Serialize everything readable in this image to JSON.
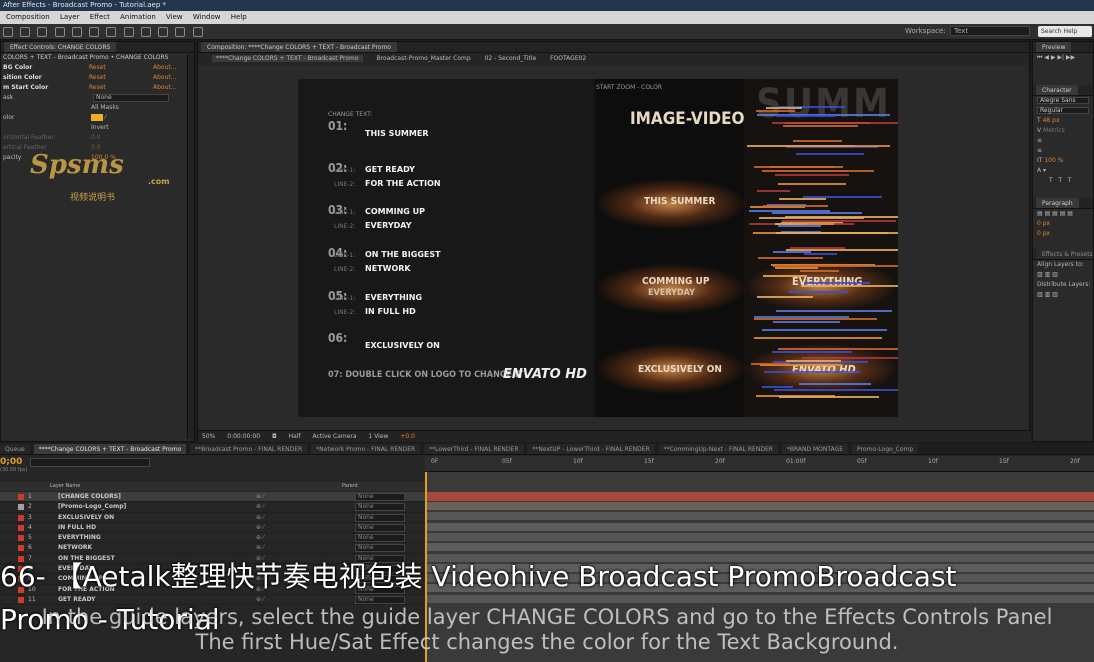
{
  "window_title": "After Effects - Broadcast Promo - Tutorial.aep *",
  "menu": [
    "Composition",
    "Layer",
    "Effect",
    "Animation",
    "View",
    "Window",
    "Help"
  ],
  "workspace_label": "Workspace:",
  "workspace_value": "Text",
  "search_help": "Search Help",
  "effect_controls": {
    "tab": "Effect Controls: CHANGE COLORS",
    "path": "COLORS + TEXT - Broadcast Promo • CHANGE COLORS",
    "rows": [
      {
        "label": "BG Color",
        "reset": "Reset",
        "about": "About..."
      },
      {
        "label": "sition Color",
        "reset": "Reset",
        "about": "About..."
      },
      {
        "label": "m Start Color",
        "reset": "Reset",
        "about": "About..."
      }
    ],
    "mask_label": "ask",
    "mask_value": "None",
    "all_masks": "All Masks",
    "color_label": "olor",
    "invert": "Invert",
    "feather1": "orizontal Feather",
    "feather2": "ertical Feather",
    "opacity": "pacity",
    "feather1_val": "0.0",
    "feather2_val": "0.0",
    "opacity_val": "100.0 %"
  },
  "watermark": {
    "main": "Spsms",
    "dotcom": ".com",
    "sub": "视频说明书"
  },
  "composition": {
    "tab": "Composition: ****Change COLORS + TEXT - Broadcast Promo",
    "breadcrumbs": [
      "****Change COLORS + TEXT - Broadcast Promo",
      "Broadcast-Promo_Master Comp",
      "02 - Second_Title",
      "FOOTAGE02"
    ],
    "change_text": "CHANGE TEXT:",
    "items": [
      {
        "num": "01:",
        "lines": [
          {
            "ln": "",
            "text": "THIS SUMMER"
          }
        ]
      },
      {
        "num": "02:",
        "lines": [
          {
            "ln": "LINE-1:",
            "text": "GET READY"
          },
          {
            "ln": "LINE-2:",
            "text": "FOR THE ACTION"
          }
        ]
      },
      {
        "num": "03:",
        "lines": [
          {
            "ln": "LINE-1:",
            "text": "COMMING UP"
          },
          {
            "ln": "LINE-2:",
            "text": "EVERYDAY"
          }
        ]
      },
      {
        "num": "04:",
        "lines": [
          {
            "ln": "LINE-1:",
            "text": "ON THE BIGGEST"
          },
          {
            "ln": "LINE-2:",
            "text": "NETWORK"
          }
        ]
      },
      {
        "num": "05:",
        "lines": [
          {
            "ln": "LINE-1:",
            "text": "EVERYTHING"
          },
          {
            "ln": "LINE-2:",
            "text": "IN FULL HD"
          }
        ]
      },
      {
        "num": "06:",
        "lines": [
          {
            "ln": "",
            "text": "EXCLUSIVELY ON"
          }
        ]
      }
    ],
    "logo_hint": "07: DOUBLE CLICK ON LOGO TO CHANGE IT",
    "logo": "ENVATO HD",
    "preview_header": "START ZOOM - COLOR",
    "preview_texts": {
      "image_video": "IMAGE-VIDEO",
      "summer": "THIS SUMMER",
      "comming": "COMMING UP",
      "everyday": "EVERYDAY",
      "everything": "EVERYTHING",
      "exclusively": "EXCLUSIVELY ON",
      "envato": "ENVATO HD",
      "big": "SUMM"
    },
    "bottom": {
      "zoom": "50%",
      "time": "0:00:00:00",
      "res": "Half",
      "camera": "Active Camera",
      "view": "1 View",
      "offset": "+0.0"
    }
  },
  "right_panel": {
    "preview": "Preview",
    "character": "Character",
    "font": "Alegre Sans",
    "style": "Regular",
    "size": "48 px",
    "metrics": "Metrics",
    "scale": "100 %",
    "paragraph": "Paragraph",
    "px1": "0 px",
    "px2": "0 px",
    "effects": "Effects & Presets",
    "align": "Align Layers to:",
    "distribute": "Distribute Layers:"
  },
  "timeline": {
    "tabs": [
      "****Change COLORS + TEXT - Broadcast Promo",
      "**Broadcast Promo - FINAL RENDER",
      "*Network Promo - FINAL RENDER",
      "**LowerThird - FINAL RENDER",
      "**NextUP - LowerThird - FINAL RENDER",
      "**CommingUp-Next - FINAL RENDER",
      "*BRAND MONTAGE",
      "Promo-Logo_Comp"
    ],
    "queue": "Queue",
    "timecode": "0;00",
    "fps": "(30.00 fps)",
    "col_layer": "Layer Name",
    "col_parent": "Parent",
    "layers": [
      {
        "n": "1",
        "name": "[CHANGE COLORS]",
        "color": "#d13a2a"
      },
      {
        "n": "2",
        "name": "[Promo-Logo_Comp]",
        "color": "#a0a0a0"
      },
      {
        "n": "3",
        "name": "EXCLUSIVELY ON",
        "color": "#d13a2a"
      },
      {
        "n": "4",
        "name": "IN FULL HD",
        "color": "#d13a2a"
      },
      {
        "n": "5",
        "name": "EVERYTHING",
        "color": "#d13a2a"
      },
      {
        "n": "6",
        "name": "NETWORK",
        "color": "#d13a2a"
      },
      {
        "n": "7",
        "name": "ON THE BIGGEST",
        "color": "#d13a2a"
      },
      {
        "n": "8",
        "name": "EVERYDAY",
        "color": "#d13a2a"
      },
      {
        "n": "9",
        "name": "COMMING UP",
        "color": "#d13a2a"
      },
      {
        "n": "10",
        "name": "FOR THE ACTION",
        "color": "#d13a2a"
      },
      {
        "n": "11",
        "name": "GET READY",
        "color": "#d13a2a"
      }
    ],
    "parent_value": "None",
    "ruler": [
      "0F",
      "05f",
      "10f",
      "15f",
      "20f",
      "01:00f",
      "05f",
      "10f",
      "15f",
      "20f"
    ]
  },
  "subtitle": "66- 【Aetalk整理快节奏电视包装 Videohive Broadcast PromoBroadcast\nPromo - Tutorial",
  "caption_line1": "In the guide layers, select the guide layer CHANGE COLORS and go to the Effects Controls Panel",
  "caption_line2": "The first  Hue/Sat Effect changes the color for the Text Background."
}
